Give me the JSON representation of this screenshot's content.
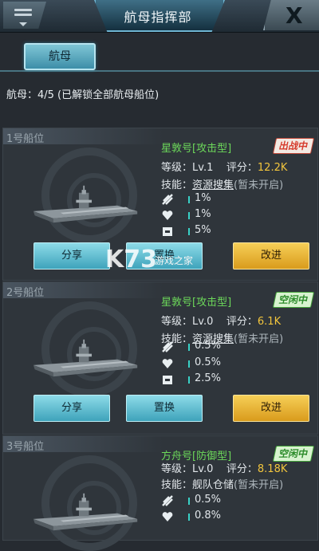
{
  "header": {
    "title": "航母指挥部",
    "close_label": "X"
  },
  "tabs": [
    {
      "label": "航母"
    }
  ],
  "summary": "航母：4/5 (已解锁全部航母船位)",
  "labels": {
    "level": "等级：",
    "score": "评分：",
    "skill": "技能："
  },
  "cards": [
    {
      "slot": "1号船位",
      "name": "星敦号[攻击型]",
      "status": "出战中",
      "level": "Lv.1",
      "score": "12.2K",
      "skill": "资源搜集",
      "skill_note": "(暂未开启)",
      "stats": [
        "1%",
        "1%",
        "5%"
      ],
      "buttons": [
        "分享",
        "置换",
        "改进"
      ]
    },
    {
      "slot": "2号船位",
      "name": "星敦号[攻击型]",
      "status": "空闲中",
      "level": "Lv.0",
      "score": "6.1K",
      "skill": "资源搜集",
      "skill_note": "(暂未开启)",
      "stats": [
        "0.5%",
        "0.5%",
        "2.5%"
      ],
      "buttons": [
        "分享",
        "置换",
        "改进"
      ]
    },
    {
      "slot": "3号船位",
      "name": "方舟号[防御型]",
      "status": "空闲中",
      "level": "Lv.0",
      "score": "8.18K",
      "skill": "舰队仓储",
      "skill_note": "(暂未开启)",
      "stats": [
        "0.5%",
        "0.8%"
      ]
    }
  ],
  "watermark": {
    "brand": "K73",
    "subtitle": "游戏之家"
  },
  "colors": {
    "score": "#f2c53d",
    "name": "#6cd85a",
    "primary_button": "#3ea3bb",
    "upgrade_button": "#d99b1c"
  },
  "icons": [
    "menu-icon",
    "attack-icon",
    "health-icon",
    "cargo-icon",
    "carrier-ship-icon"
  ]
}
